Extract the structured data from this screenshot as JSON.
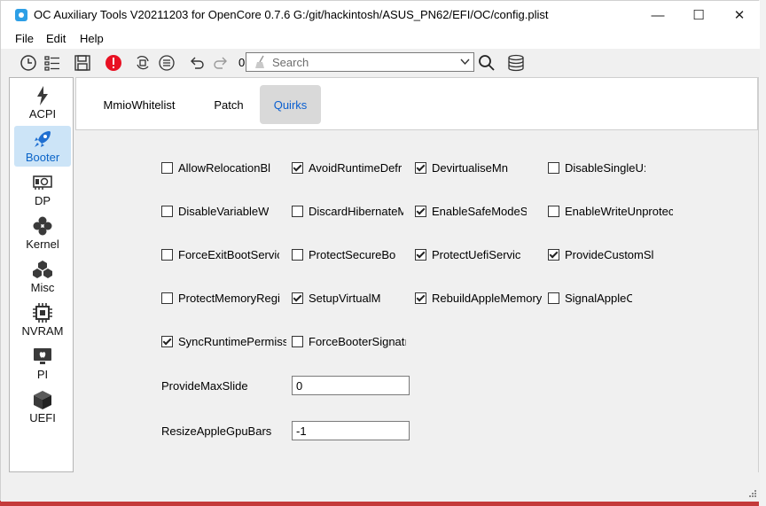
{
  "window": {
    "title": "OC Auxiliary Tools    V20211203 for OpenCore 0.7.6    G:/git/hackintosh/ASUS_PN62/EFI/OC/config.plist",
    "minimize": "—",
    "maximize": "☐",
    "close": "✕"
  },
  "menu": {
    "file": "File",
    "edit": "Edit",
    "help": "Help"
  },
  "toolbar": {
    "counter": "0",
    "search_placeholder": "Search"
  },
  "sidebar": {
    "items": [
      {
        "label": "ACPI",
        "icon": "bolt-icon"
      },
      {
        "label": "Booter",
        "icon": "rocket-icon",
        "active": true
      },
      {
        "label": "DP",
        "icon": "gpu-card-icon"
      },
      {
        "label": "Kernel",
        "icon": "kernel-icon"
      },
      {
        "label": "Misc",
        "icon": "cubes-icon"
      },
      {
        "label": "NVRAM",
        "icon": "chip-icon"
      },
      {
        "label": "PI",
        "icon": "apple-monitor-icon"
      },
      {
        "label": "UEFI",
        "icon": "cube-icon"
      }
    ]
  },
  "tabs": [
    {
      "label": "MmioWhitelist"
    },
    {
      "label": "Patch"
    },
    {
      "label": "Quirks",
      "active": true
    }
  ],
  "quirks": [
    {
      "label": "AllowRelocationBl",
      "checked": false
    },
    {
      "label": "AvoidRuntimeDefr",
      "checked": true
    },
    {
      "label": "DevirtualiseMn",
      "checked": true
    },
    {
      "label": "DisableSingleU:",
      "checked": false
    },
    {
      "label": "DisableVariableW",
      "checked": false
    },
    {
      "label": "DiscardHibernateM",
      "checked": false
    },
    {
      "label": "EnableSafeModeS",
      "checked": true
    },
    {
      "label": "EnableWriteUnprotec",
      "checked": false
    },
    {
      "label": "ForceExitBootServic",
      "checked": false
    },
    {
      "label": "ProtectSecureBo",
      "checked": false
    },
    {
      "label": "ProtectUefiServic",
      "checked": true
    },
    {
      "label": "ProvideCustomSl",
      "checked": true
    },
    {
      "label": "ProtectMemoryRegi",
      "checked": false
    },
    {
      "label": "SetupVirtualM",
      "checked": true
    },
    {
      "label": "RebuildAppleMemory",
      "checked": true
    },
    {
      "label": "SignalAppleC",
      "checked": false
    },
    {
      "label": "SyncRuntimePermissi",
      "checked": true
    },
    {
      "label": "ForceBooterSignatı",
      "checked": false
    }
  ],
  "fields": {
    "provide_max_slide": {
      "label": "ProvideMaxSlide",
      "value": "0"
    },
    "resize_apple_gpu_bars": {
      "label": "ResizeAppleGpuBars",
      "value": "-1"
    }
  },
  "colors": {
    "accent": "#0a5fd0",
    "active_bg": "#cce4f7",
    "error_icon": "#e81123",
    "app_icon": "#2d9fe6"
  }
}
